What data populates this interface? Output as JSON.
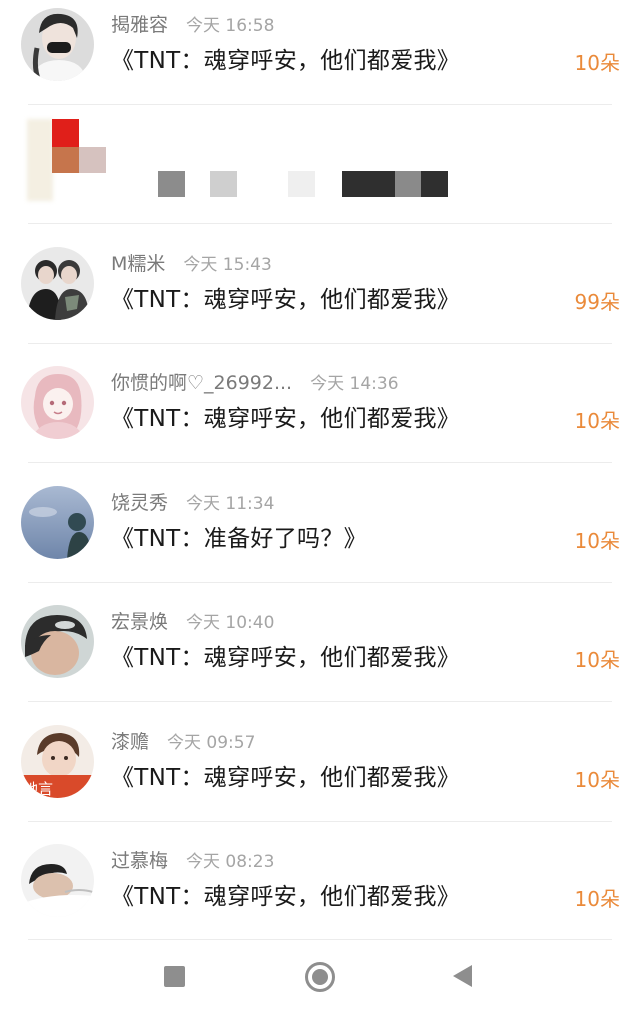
{
  "rows": [
    {
      "name": "揭雅容",
      "time": "今天 16:58",
      "title": "《TNT：魂穿呼安，他们都爱我》",
      "count": "10朵",
      "avatar": "avatar-girl-black-mask"
    },
    {
      "name": "M糯米",
      "time": "今天 15:43",
      "title": "《TNT：魂穿呼安，他们都爱我》",
      "count": "99朵",
      "avatar": "avatar-two-boys"
    },
    {
      "name": "你惯的啊♡_26992...",
      "time": "今天 14:36",
      "title": "《TNT：魂穿呼安，他们都爱我》",
      "count": "10朵",
      "avatar": "avatar-pink-anime"
    },
    {
      "name": "饶灵秀",
      "time": "今天 11:34",
      "title": "《TNT：准备好了吗？》",
      "count": "10朵",
      "avatar": "avatar-blue-sky"
    },
    {
      "name": "宏景焕",
      "time": "今天 10:40",
      "title": "《TNT：魂穿呼安，他们都爱我》",
      "count": "10朵",
      "avatar": "avatar-boy-face"
    },
    {
      "name": "漆赡",
      "time": "今天 09:57",
      "title": "《TNT：魂穿呼安，他们都爱我》",
      "count": "10朵",
      "avatar": "avatar-boy-red-sign"
    },
    {
      "name": "过慕梅",
      "time": "今天 08:23",
      "title": "《TNT：魂穿呼安，他们都爱我》",
      "count": "10朵",
      "avatar": "avatar-boy-lying"
    }
  ],
  "avatar_sign_text": "她言",
  "colors": {
    "count": "#ea8a3a",
    "name": "#7a7a7a",
    "time": "#a5a5a5",
    "title": "#1a1a1a",
    "nav": "#8e8e8e"
  },
  "nav": {
    "recents": "square-icon",
    "home": "circle-icon",
    "back": "triangle-back-icon"
  }
}
